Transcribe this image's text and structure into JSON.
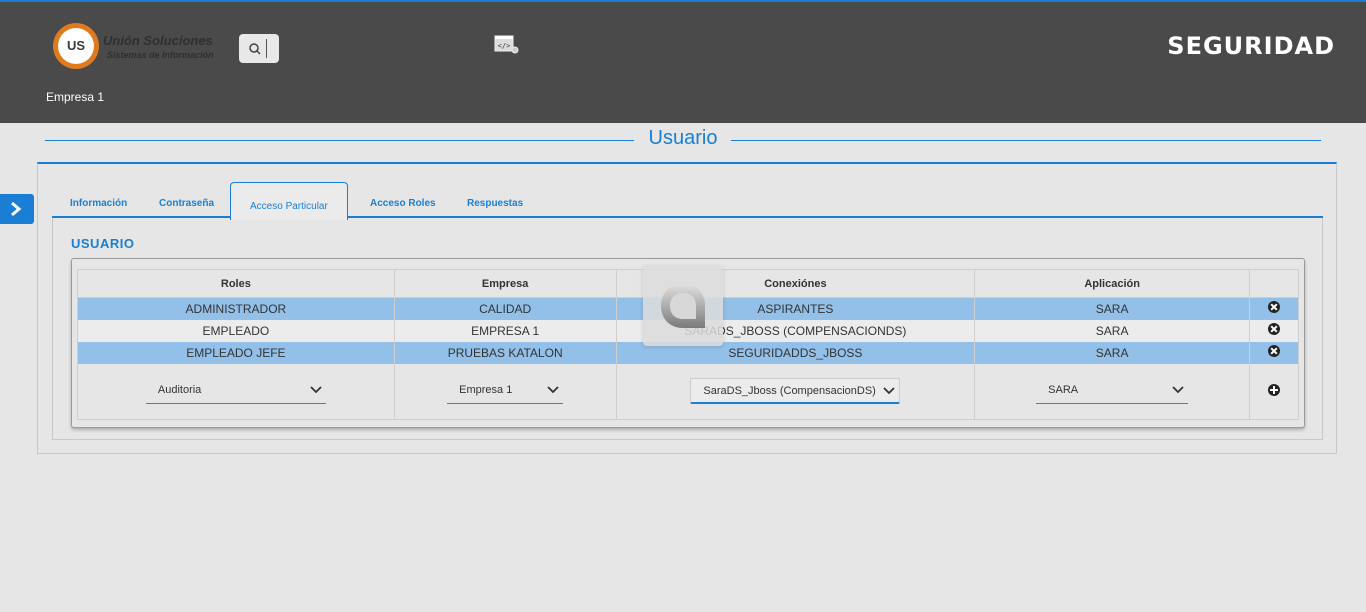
{
  "header": {
    "logo_title": "Unión Soluciones",
    "logo_subtitle": "Sistemas de Información",
    "logo_mark": "US",
    "brand": "SEGURIDAD",
    "company": "Empresa 1"
  },
  "page": {
    "title": "Usuario"
  },
  "tabs": [
    {
      "label": "Información"
    },
    {
      "label": "Contraseña"
    },
    {
      "label": "Acceso Particular",
      "active": true
    },
    {
      "label": "Acceso Roles"
    },
    {
      "label": "Respuestas"
    }
  ],
  "section": {
    "title": "USUARIO"
  },
  "table": {
    "headers": [
      "Roles",
      "Empresa",
      "Conexiónes",
      "Aplicación",
      ""
    ],
    "rows": [
      {
        "rol": "ADMINISTRADOR",
        "empresa": "CALIDAD",
        "conexion": "ASPIRANTES",
        "aplicacion": "SARA"
      },
      {
        "rol": "EMPLEADO",
        "empresa": "EMPRESA 1",
        "conexion": "SARADS_JBOSS (COMPENSACIONDS)",
        "aplicacion": "SARA"
      },
      {
        "rol": "EMPLEADO JEFE",
        "empresa": "PRUEBAS KATALON",
        "conexion": "SEGURIDADDS_JBOSS",
        "aplicacion": "SARA"
      }
    ],
    "new_row": {
      "rol": "Auditoria",
      "empresa": "Empresa 1",
      "conexion": "SaraDS_Jboss (CompensacionDS)",
      "aplicacion": "SARA"
    }
  },
  "colors": {
    "accent": "#1a7fd4",
    "header_bg": "#4a4a4a",
    "highlight_row": "#93c0e8",
    "logo_orange": "#e07a1f"
  }
}
